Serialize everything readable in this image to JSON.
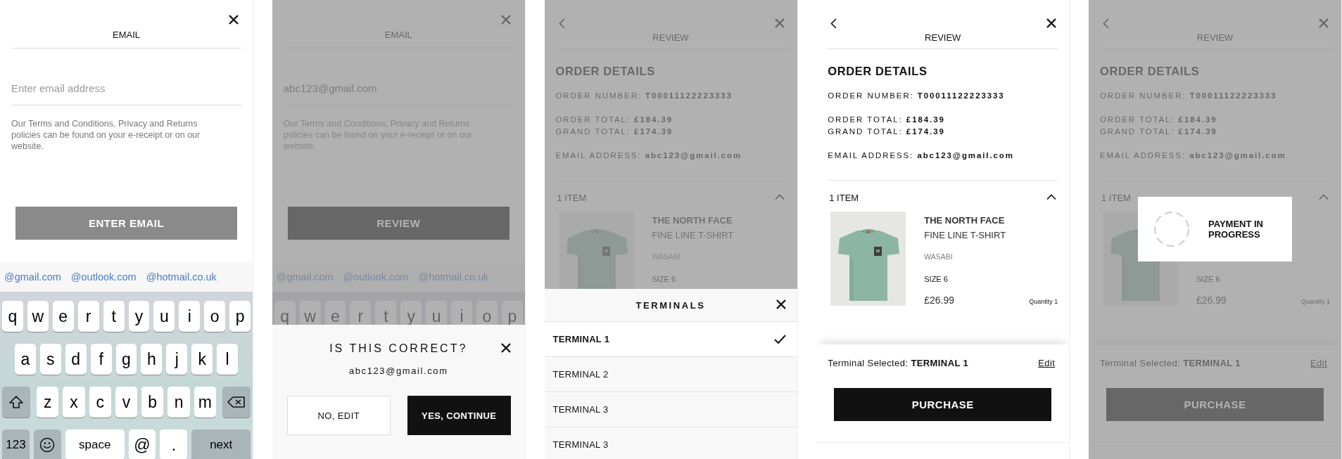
{
  "screens": [
    {
      "kind": "email",
      "dimmed": false,
      "title": "EMAIL",
      "field": {
        "placeholder": "Enter email address"
      },
      "note": "Our Terms and Conditions, Privacy and Returns policies can be found on your e-receipt or on our website.",
      "button": {
        "label": "ENTER EMAIL",
        "disabled": true
      },
      "suggestions": [
        "@gmail.com",
        "@outlook.com",
        "@hotmail.co.uk"
      ],
      "keyboard": [
        [
          {
            "kind": "letter",
            "label": "q"
          },
          {
            "kind": "letter",
            "label": "w"
          },
          {
            "kind": "letter",
            "label": "e"
          },
          {
            "kind": "letter",
            "label": "r"
          },
          {
            "kind": "letter",
            "label": "t"
          },
          {
            "kind": "letter",
            "label": "y"
          },
          {
            "kind": "letter",
            "label": "u"
          },
          {
            "kind": "letter",
            "label": "i"
          },
          {
            "kind": "letter",
            "label": "o"
          },
          {
            "kind": "letter",
            "label": "p"
          }
        ],
        [
          {
            "kind": "letter",
            "label": "a"
          },
          {
            "kind": "letter",
            "label": "s"
          },
          {
            "kind": "letter",
            "label": "d"
          },
          {
            "kind": "letter",
            "label": "f"
          },
          {
            "kind": "letter",
            "label": "g"
          },
          {
            "kind": "letter",
            "label": "h"
          },
          {
            "kind": "letter",
            "label": "j"
          },
          {
            "kind": "letter",
            "label": "k"
          },
          {
            "kind": "letter",
            "label": "l"
          }
        ],
        [
          {
            "kind": "shift"
          },
          {
            "kind": "letter",
            "label": "z"
          },
          {
            "kind": "letter",
            "label": "x"
          },
          {
            "kind": "letter",
            "label": "c"
          },
          {
            "kind": "letter",
            "label": "v"
          },
          {
            "kind": "letter",
            "label": "b"
          },
          {
            "kind": "letter",
            "label": "n"
          },
          {
            "kind": "letter",
            "label": "m"
          },
          {
            "kind": "backspace"
          }
        ],
        [
          {
            "kind": "mode",
            "label": "123"
          },
          {
            "kind": "emoji"
          },
          {
            "kind": "space",
            "label": "space"
          },
          {
            "kind": "symbol",
            "label": "@"
          },
          {
            "kind": "symbol",
            "label": "."
          },
          {
            "kind": "action",
            "label": "next"
          }
        ]
      ]
    },
    {
      "kind": "email",
      "dimmed": true,
      "title": "EMAIL",
      "field": {
        "value": "abc123@gmail.com"
      },
      "note": "Our Terms and Conditions, Privacy and Returns policies can be found on your e-receipt or on our website.",
      "button": {
        "label": "REVIEW",
        "disabled": false
      },
      "suggestions": [
        "@gmail.com",
        "@outlook.com",
        "@hotmail.co.uk"
      ],
      "keyboard": [
        [
          {
            "kind": "letter",
            "label": "q"
          },
          {
            "kind": "letter",
            "label": "w"
          },
          {
            "kind": "letter",
            "label": "e"
          },
          {
            "kind": "letter",
            "label": "r"
          },
          {
            "kind": "letter",
            "label": "t"
          },
          {
            "kind": "letter",
            "label": "y"
          },
          {
            "kind": "letter",
            "label": "u"
          },
          {
            "kind": "letter",
            "label": "i"
          },
          {
            "kind": "letter",
            "label": "o"
          },
          {
            "kind": "letter",
            "label": "p"
          }
        ]
      ],
      "sheet": {
        "kind": "confirm",
        "title": "IS THIS CORRECT?",
        "email": "abc123@gmail.com",
        "buttons": [
          {
            "kind": "secondary",
            "label": "NO, EDIT"
          },
          {
            "kind": "primary",
            "label": "YES, CONTINUE"
          }
        ]
      }
    },
    {
      "kind": "review",
      "dimmed": true,
      "title": "REVIEW",
      "heading": "ORDER DETAILS",
      "details": [
        [
          "ORDER NUMBER: **T00011122223333**"
        ],
        [
          "ORDER TOTAL: **£184.39**",
          "GRAND TOTAL: **£174.39**"
        ],
        [
          "EMAIL ADDRESS: **abc123@gmail.com**"
        ]
      ],
      "items": {
        "label": "1 ITEM",
        "expanded": true
      },
      "product": {
        "kind": "picture",
        "brand": "THE NORTH FACE",
        "name": "FINE LINE T-SHIRT",
        "variant": "WASABI",
        "size": "SIZE 6"
      },
      "sheet": {
        "kind": "terminals",
        "title": "TERMINALS",
        "items": [
          {
            "label": "TERMINAL 1",
            "selected": true
          },
          {
            "label": "TERMINAL 2",
            "selected": false
          },
          {
            "label": "TERMINAL 3",
            "selected": false
          },
          {
            "label": "TERMINAL 3",
            "selected": false
          }
        ]
      }
    },
    {
      "kind": "review",
      "dimmed": false,
      "title": "REVIEW",
      "heading": "ORDER DETAILS",
      "details": [
        [
          "ORDER NUMBER: **T00011122223333**"
        ],
        [
          "ORDER TOTAL: **£184.39**",
          "GRAND TOTAL: **£174.39**"
        ],
        [
          "EMAIL ADDRESS: **abc123@gmail.com**"
        ]
      ],
      "items": {
        "label": "1 ITEM",
        "expanded": true
      },
      "product": {
        "kind": "picture",
        "brand": "THE NORTH FACE",
        "name": "FINE LINE T-SHIRT",
        "variant": "WASABI",
        "size": "SIZE 6",
        "price": "£26.99",
        "quantity": "Quantity 1"
      },
      "footer": {
        "terminal": "Terminal Selected: **TERMINAL 1**",
        "edit": "Edit",
        "button": {
          "label": "PURCHASE",
          "disabled": false
        }
      }
    },
    {
      "kind": "review",
      "dimmed": true,
      "title": "REVIEW",
      "heading": "ORDER DETAILS",
      "details": [
        [
          "ORDER NUMBER: **T00011122223333**"
        ],
        [
          "ORDER TOTAL: **£184.39**",
          "GRAND TOTAL: **£174.39**"
        ],
        [
          "EMAIL ADDRESS: **abc123@gmail.com**"
        ]
      ],
      "items": {
        "label": "1 ITEM",
        "expanded": true
      },
      "product": {
        "kind": "picture",
        "size": "SIZE 6",
        "price": "£26.99",
        "quantity": "Quantity 1"
      },
      "footer": {
        "terminal": "Terminal Selected: **TERMINAL 1**",
        "edit": "Edit",
        "button": {
          "label": "PURCHASE",
          "disabled": false
        }
      },
      "dialog": {
        "kind": "progress",
        "message": "PAYMENT IN PROGRESS"
      }
    }
  ]
}
